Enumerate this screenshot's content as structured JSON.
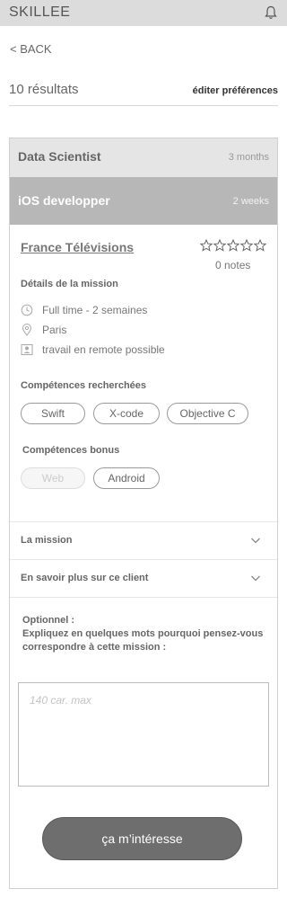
{
  "app": {
    "title": "SKILLEE"
  },
  "nav": {
    "back_label": "< BACK"
  },
  "results": {
    "count_label": "10 résultats",
    "prefs_label": "éditer préférences"
  },
  "jobs": [
    {
      "title": "Data Scientist",
      "duration": "3 months"
    },
    {
      "title": "iOS developper",
      "duration": "2 weeks"
    }
  ],
  "detail": {
    "client": "France Télévisions",
    "rating": {
      "stars": 0,
      "max": 5,
      "notes_label": "0 notes"
    },
    "mission_details_label": "Détails de la mission",
    "items": [
      {
        "icon": "clock-icon",
        "text": "Full time - 2 semaines"
      },
      {
        "icon": "location-pin-icon",
        "text": "Paris"
      },
      {
        "icon": "remote-user-icon",
        "text": "travail en remote possible"
      }
    ],
    "skills_label": "Compétences recherchées",
    "skills": [
      "Swift",
      "X-code",
      "Objective C"
    ],
    "bonus_label": "Compétences bonus",
    "bonus_skills": [
      {
        "label": "Web",
        "active": false
      },
      {
        "label": "Android",
        "active": true
      }
    ],
    "accordions": [
      "La mission",
      "En savoir plus sur ce client"
    ],
    "optional": {
      "line1": "Optionnel :",
      "line2": "Expliquez en quelques mots pourquoi pensez-vous correspondre à cette mission :"
    },
    "textarea_placeholder": "140 car. max",
    "cta_label": "ça m’intéresse"
  },
  "colors": {
    "topbar": "#dcdcdc",
    "selected_row": "#b7b7b7",
    "cta": "#6e6e6e"
  }
}
